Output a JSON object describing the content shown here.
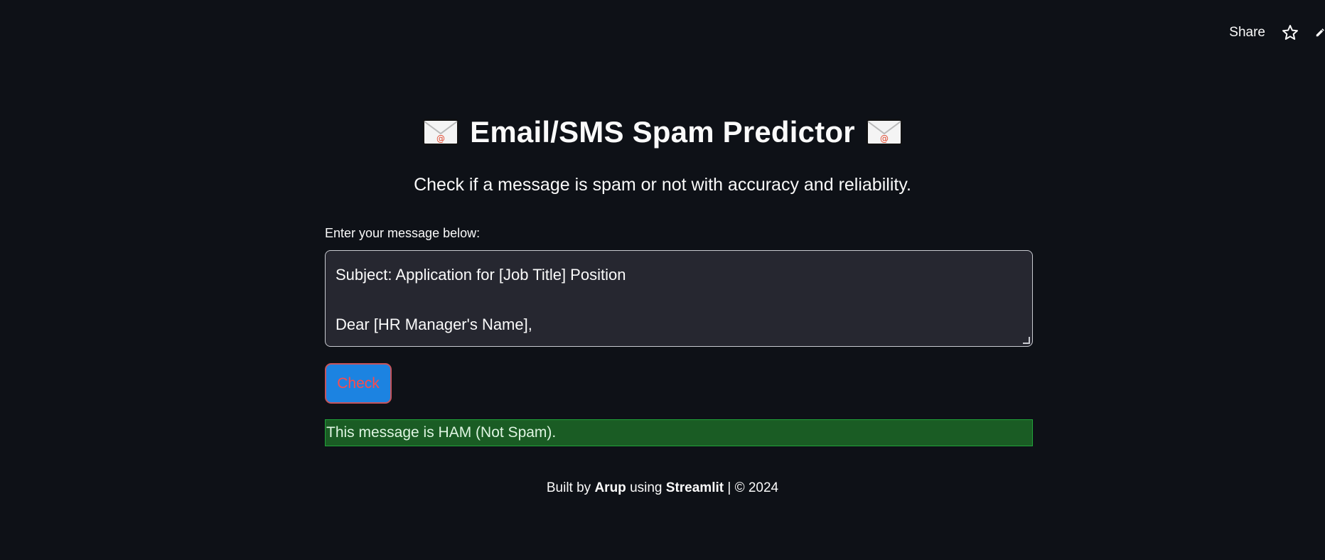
{
  "toolbar": {
    "share_label": "Share",
    "star_icon": "star-icon",
    "edit_icon": "pencil-icon"
  },
  "header": {
    "icon": "envelope-icon",
    "title": "Email/SMS Spam Predictor",
    "subtitle": "Check if a message is spam or not with accuracy and reliability."
  },
  "form": {
    "label": "Enter your message below:",
    "message_value": "Subject: Application for [Job Title] Position\n\nDear [HR Manager's Name],",
    "check_label": "Check"
  },
  "result": {
    "text": "This message is HAM (Not Spam).",
    "status": "ham"
  },
  "footer": {
    "prefix": "Built by",
    "author": "Arup",
    "middle": "using",
    "framework": "Streamlit",
    "suffix": "| © 2024"
  },
  "colors": {
    "background": "#0e1117",
    "input_background": "#262730",
    "button_background": "#1c83e1",
    "button_text": "#ff4b4b",
    "success_background": "#1a5c24",
    "success_border": "#21a33a"
  }
}
